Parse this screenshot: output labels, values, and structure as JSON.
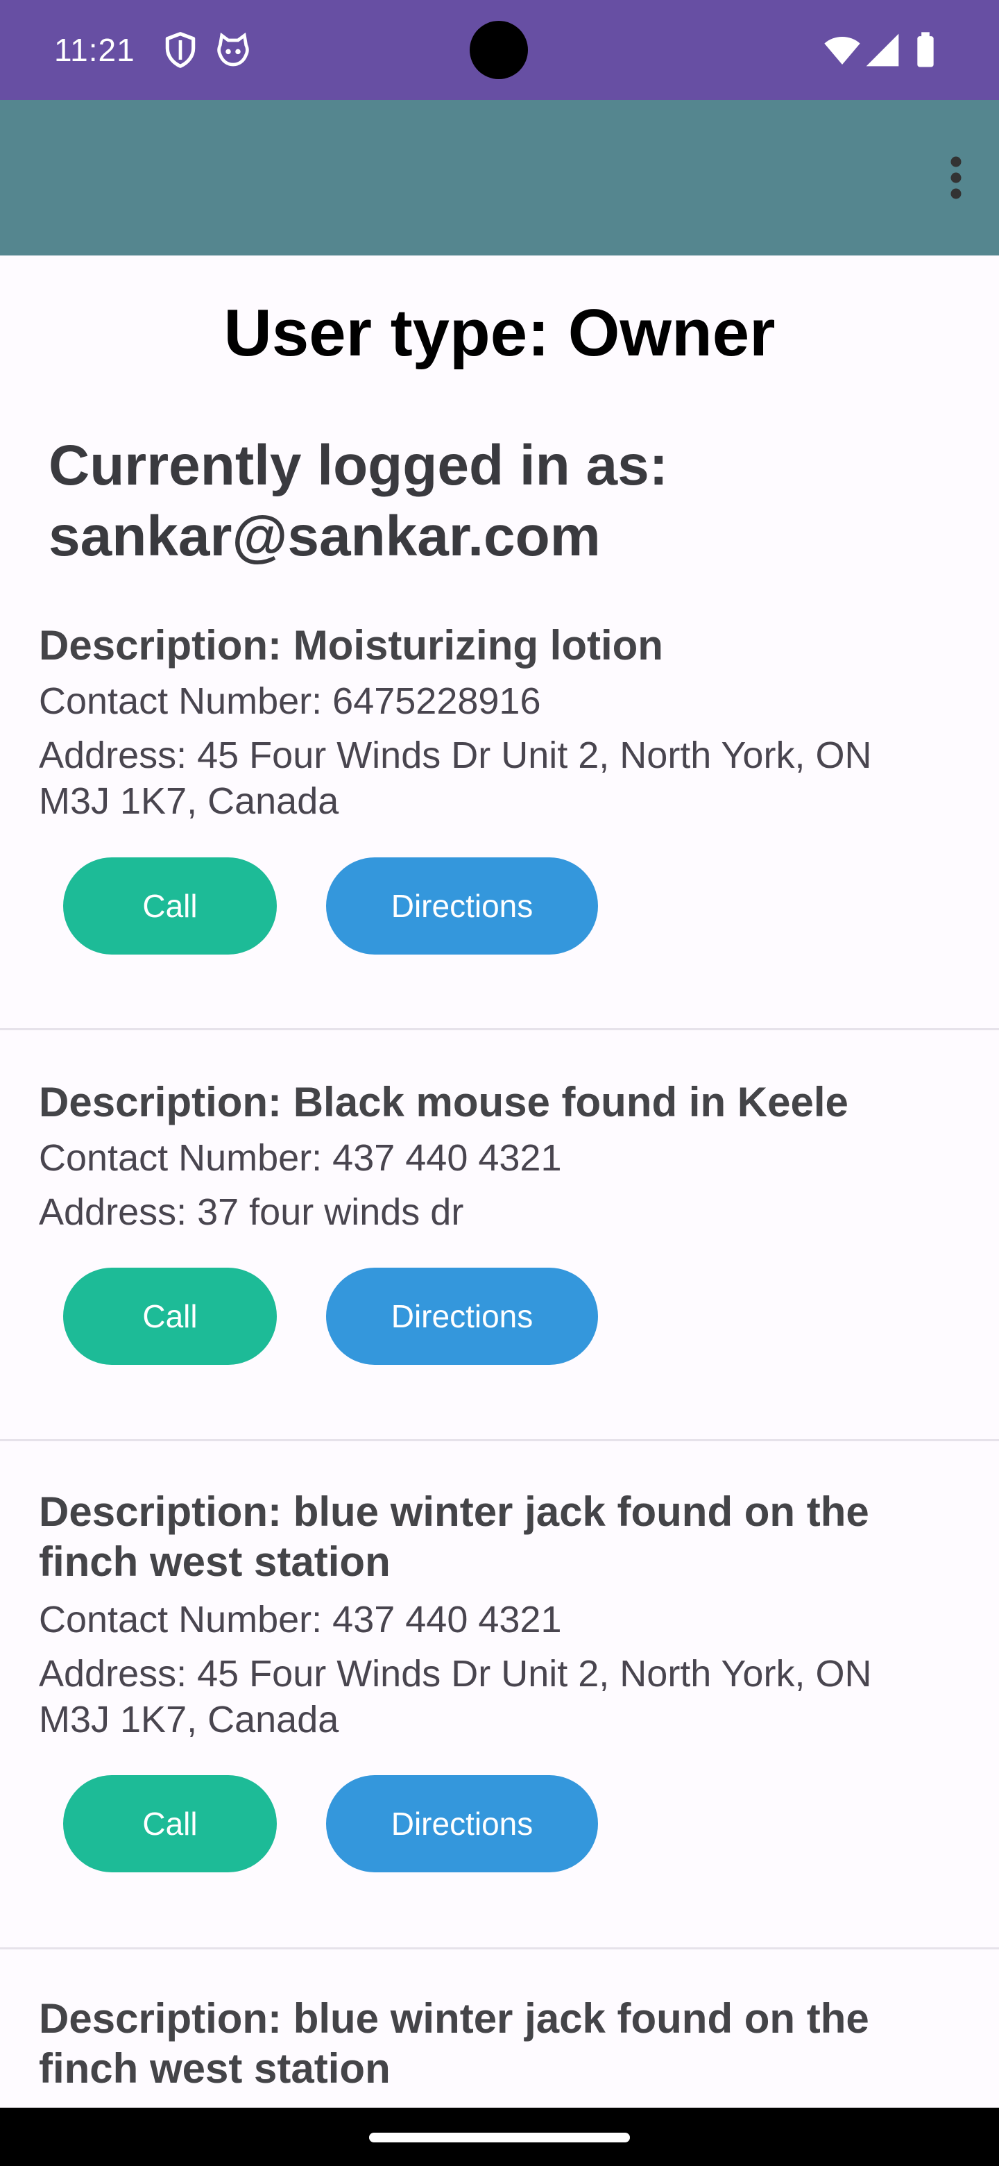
{
  "status_bar": {
    "time": "11:21",
    "background_color": "#674fa3",
    "left_icons": [
      "shield-icon",
      "cat-face-icon"
    ],
    "right_icons": [
      "wifi-icon",
      "cellular-signal-icon",
      "battery-icon"
    ]
  },
  "app_bar": {
    "background_color": "#55868f",
    "menu_icon": "more-vert-icon"
  },
  "header": {
    "user_type": "User type: Owner",
    "logged_in": "Currently logged in as: sankar@sankar.com"
  },
  "listings": [
    {
      "description": "Description: Moisturizing lotion",
      "contact": "Contact Number: 6475228916",
      "address": "Address: 45 Four Winds Dr Unit 2, North York, ON M3J 1K7, Canada",
      "call_label": "Call",
      "directions_label": "Directions"
    },
    {
      "description": "Description: Black mouse found in Keele",
      "contact": "Contact Number: 437 440 4321",
      "address": "Address: 37 four winds dr",
      "call_label": "Call",
      "directions_label": "Directions"
    },
    {
      "description": "Description: blue winter jack found on the finch west station",
      "contact": "Contact Number: 437 440 4321",
      "address": "Address: 45 Four Winds Dr Unit 2, North York, ON M3J 1K7, Canada",
      "call_label": "Call",
      "directions_label": "Directions"
    },
    {
      "description": "Description: blue winter jack found on the finch west station"
    }
  ],
  "colors": {
    "call_button": "#1dbb97",
    "directions_button": "#3497dc"
  }
}
